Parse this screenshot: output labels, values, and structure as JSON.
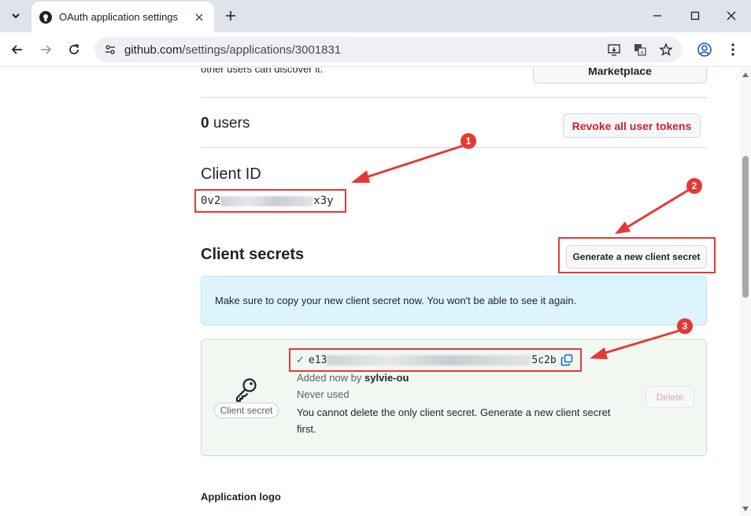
{
  "browser": {
    "tab_title": "OAuth application settings",
    "url_host": "github.com",
    "url_path": "/settings/applications/3001831"
  },
  "page": {
    "cut_text": "other users can discover it.",
    "marketplace_button": "Marketplace",
    "users_count": "0",
    "users_label": "users",
    "revoke_button": "Revoke all user tokens",
    "client_id_heading": "Client ID",
    "client_id_prefix": "0v2",
    "client_id_suffix": "x3y",
    "client_secrets_heading": "Client secrets",
    "generate_button": "Generate a new client secret",
    "flash_message": "Make sure to copy your new client secret now. You won't be able to see it again.",
    "secret": {
      "key_label": "Client secret",
      "value_prefix": "e13",
      "value_suffix": "5c2b",
      "added_by_text": "Added now by",
      "added_by_user": "sylvie-ou",
      "usage": "Never used",
      "warning": "You cannot delete the only client secret. Generate a new client secret first.",
      "delete_button": "Delete"
    },
    "logo_heading": "Application logo"
  },
  "annotations": {
    "one": "1",
    "two": "2",
    "three": "3",
    "color": "#e53935"
  },
  "icons": {
    "github": "github-logo-icon",
    "key": "key-icon",
    "copy": "copy-icon",
    "check": "check-icon"
  }
}
